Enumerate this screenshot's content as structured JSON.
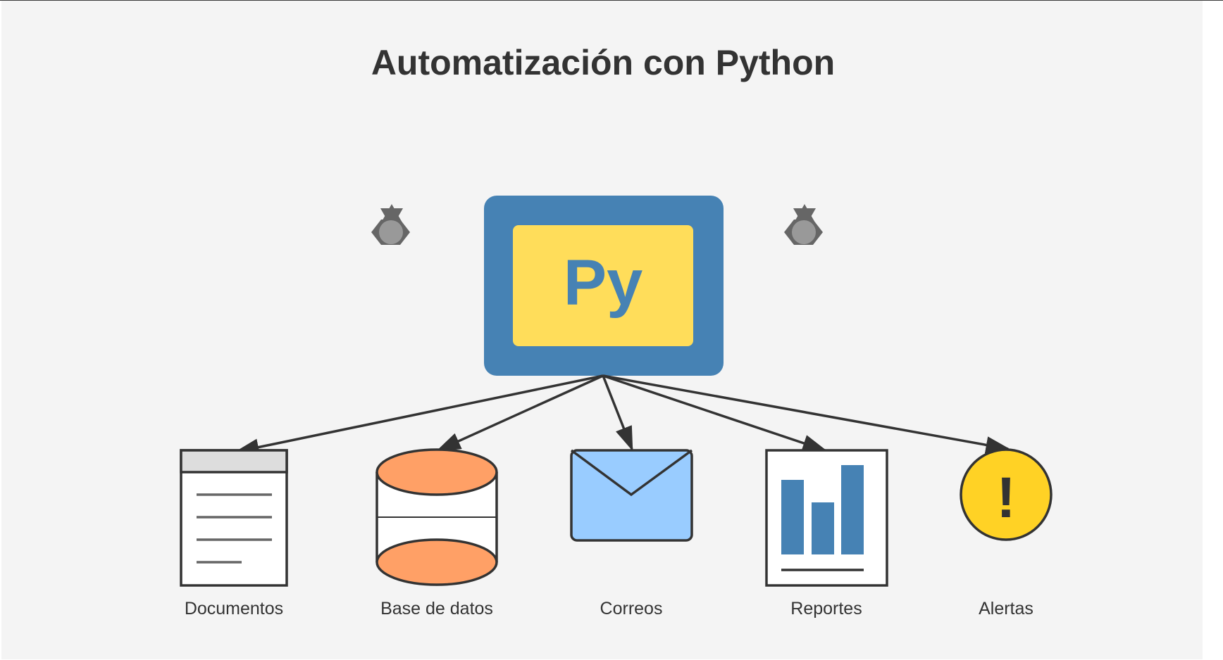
{
  "title": "Automatización con Python",
  "center_node": {
    "label": "Py",
    "icon": "python-logo-icon"
  },
  "decorations": [
    {
      "icon": "gear-icon"
    },
    {
      "icon": "gear-icon"
    }
  ],
  "targets": [
    {
      "label": "Documentos",
      "icon": "document-icon"
    },
    {
      "label": "Base de datos",
      "icon": "database-icon"
    },
    {
      "label": "Correos",
      "icon": "envelope-icon"
    },
    {
      "label": "Reportes",
      "icon": "bar-chart-icon"
    },
    {
      "label": "Alertas",
      "icon": "alert-icon",
      "symbol": "!"
    }
  ],
  "colors": {
    "background": "#f4f4f4",
    "python_blue": "#4682b4",
    "python_yellow": "#ffdd5a",
    "database_orange": "#ffa066",
    "envelope_blue": "#99ccff",
    "alert_yellow": "#ffd225",
    "gear_gray": "#666666",
    "stroke": "#333333"
  }
}
